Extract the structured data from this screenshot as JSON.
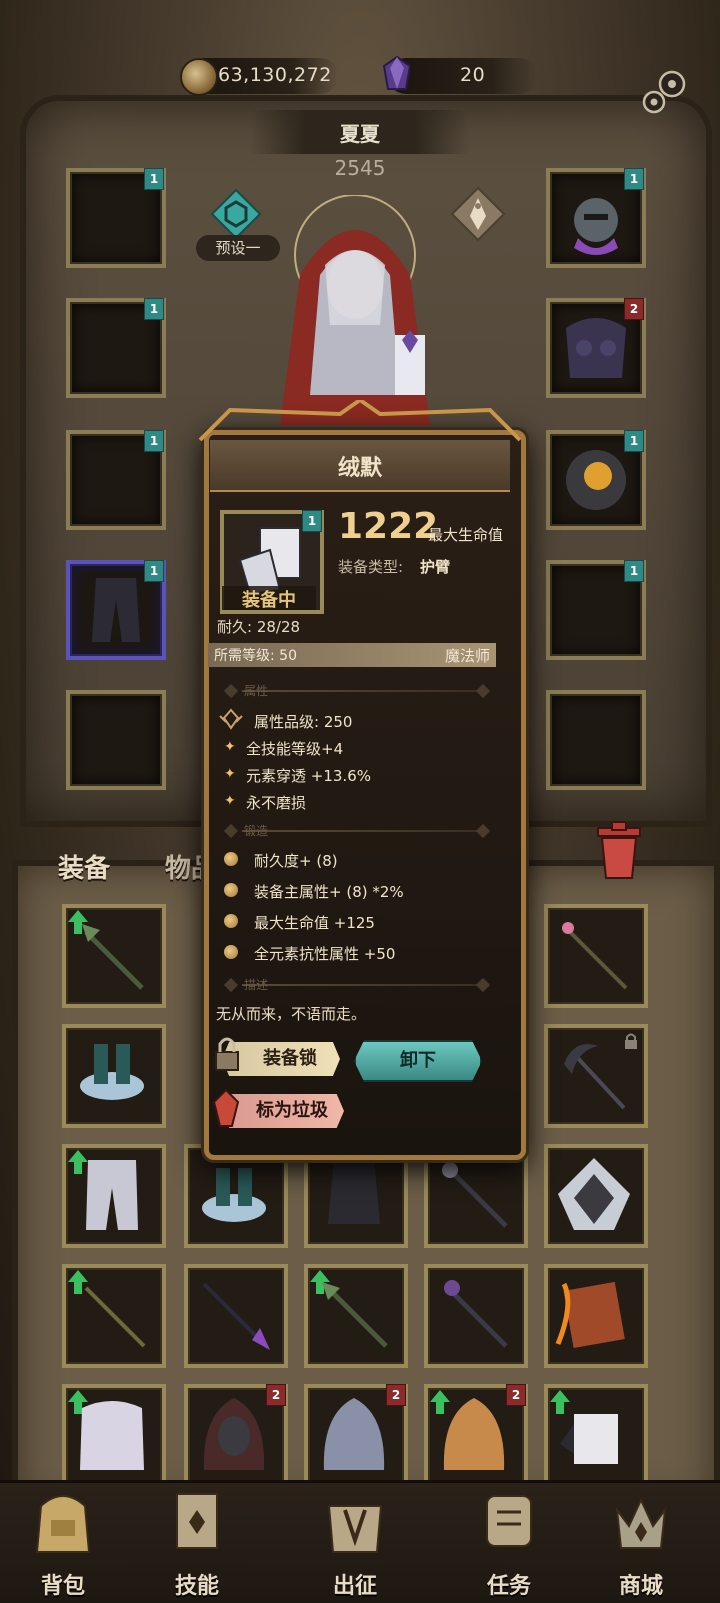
{
  "header": {
    "gold": "63,130,272",
    "gems": "20",
    "character_name": "夏夏",
    "power": "2545",
    "preset": "预设一"
  },
  "equipment_tags": [
    "1",
    "1",
    "1",
    "1",
    "1",
    "1",
    "2",
    "1",
    "1",
    "1"
  ],
  "bag": {
    "tab_equipment": "装备",
    "tab_items": "物品",
    "slot_tags": [
      "2",
      "2",
      "2"
    ]
  },
  "popup": {
    "title": "绒默",
    "equipped": "装备中",
    "item_tag": "1",
    "main_stat_value": "1222",
    "main_stat_name": "最大生命值",
    "type_label": "装备类型:",
    "type_value": "护臂",
    "durability": "耐久: 28/28",
    "required_level": "所需等级: 50",
    "required_class": "魔法师",
    "section_attributes": "属性",
    "attr_quality": "属性品级: 250",
    "attr_lines": [
      "全技能等级+4",
      "元素穿透 +13.6%",
      "永不磨损"
    ],
    "section_forge": "锻造",
    "forge_lines": [
      "耐久度+ (8)",
      "装备主属性+ (8) *2%",
      "最大生命值 +125",
      "全元素抗性属性 +50"
    ],
    "section_desc": "描述",
    "description": "无从而来，不语而走。",
    "lock_button": "装备锁",
    "unequip_button": "卸下",
    "trash_button": "标为垃圾"
  },
  "nav": {
    "items": [
      {
        "label": "背包"
      },
      {
        "label": "技能"
      },
      {
        "label": "出征"
      },
      {
        "label": "任务"
      },
      {
        "label": "商城"
      }
    ]
  },
  "colors": {
    "accent": "#3a8a84",
    "frame": "#8a7c54",
    "gold_text": "#f0d090"
  }
}
